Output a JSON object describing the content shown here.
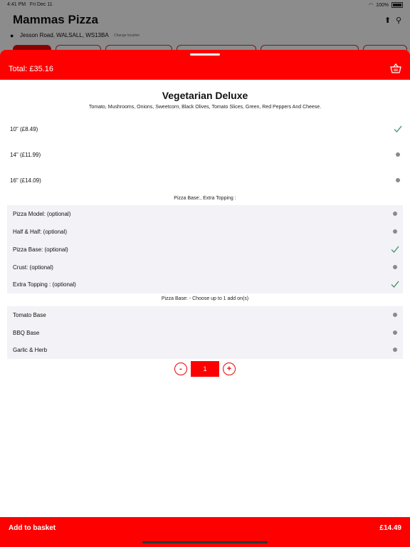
{
  "status": {
    "time": "4:41 PM",
    "date": "Fri Dec 11",
    "battery": "100%"
  },
  "background": {
    "restaurant": "Mammas Pizza",
    "address": "Jesson Road, WALSALL, WS13BA",
    "change_location": "Change location"
  },
  "header": {
    "total": "Total: £35.16",
    "icon": "basket-icon"
  },
  "product": {
    "title": "Vegetarian Deluxe",
    "description": "Tomato, Mushrooms, Onions, Sweetcorn, Black Olives, Tomato Slices, Green, Red Peppers And Cheese."
  },
  "sizes": [
    {
      "label": "10\" (£8.49)",
      "selected": true
    },
    {
      "label": "14\" (£11.99)",
      "selected": false
    },
    {
      "label": "16\" (£14.09)",
      "selected": false
    }
  ],
  "groups": [
    {
      "title": "Pizza Base:, Extra Topping :",
      "options": [
        {
          "label": "Pizza Model: (optional)",
          "selected": false
        },
        {
          "label": "Half & Half: (optional)",
          "selected": false
        },
        {
          "label": "Pizza Base: (optional)",
          "selected": true
        },
        {
          "label": " Crust: (optional)",
          "selected": false
        },
        {
          "label": "Extra Topping : (optional)",
          "selected": true
        }
      ]
    },
    {
      "title": "Pizza Base: - Choose up to 1 add on(s)",
      "options": [
        {
          "label": "Tomato Base",
          "selected": false
        },
        {
          "label": "BBQ Base",
          "selected": false
        },
        {
          "label": "Garlic & Herb",
          "selected": false
        }
      ]
    }
  ],
  "quantity": {
    "minus": "-",
    "value": "1",
    "plus": "+"
  },
  "footer": {
    "add_label": "Add to basket",
    "price": "£14.49"
  },
  "colors": {
    "accent": "#ff0000",
    "check": "#2e8b57",
    "dot": "#8a8a8a",
    "group_bg": "#f2f2f7"
  }
}
